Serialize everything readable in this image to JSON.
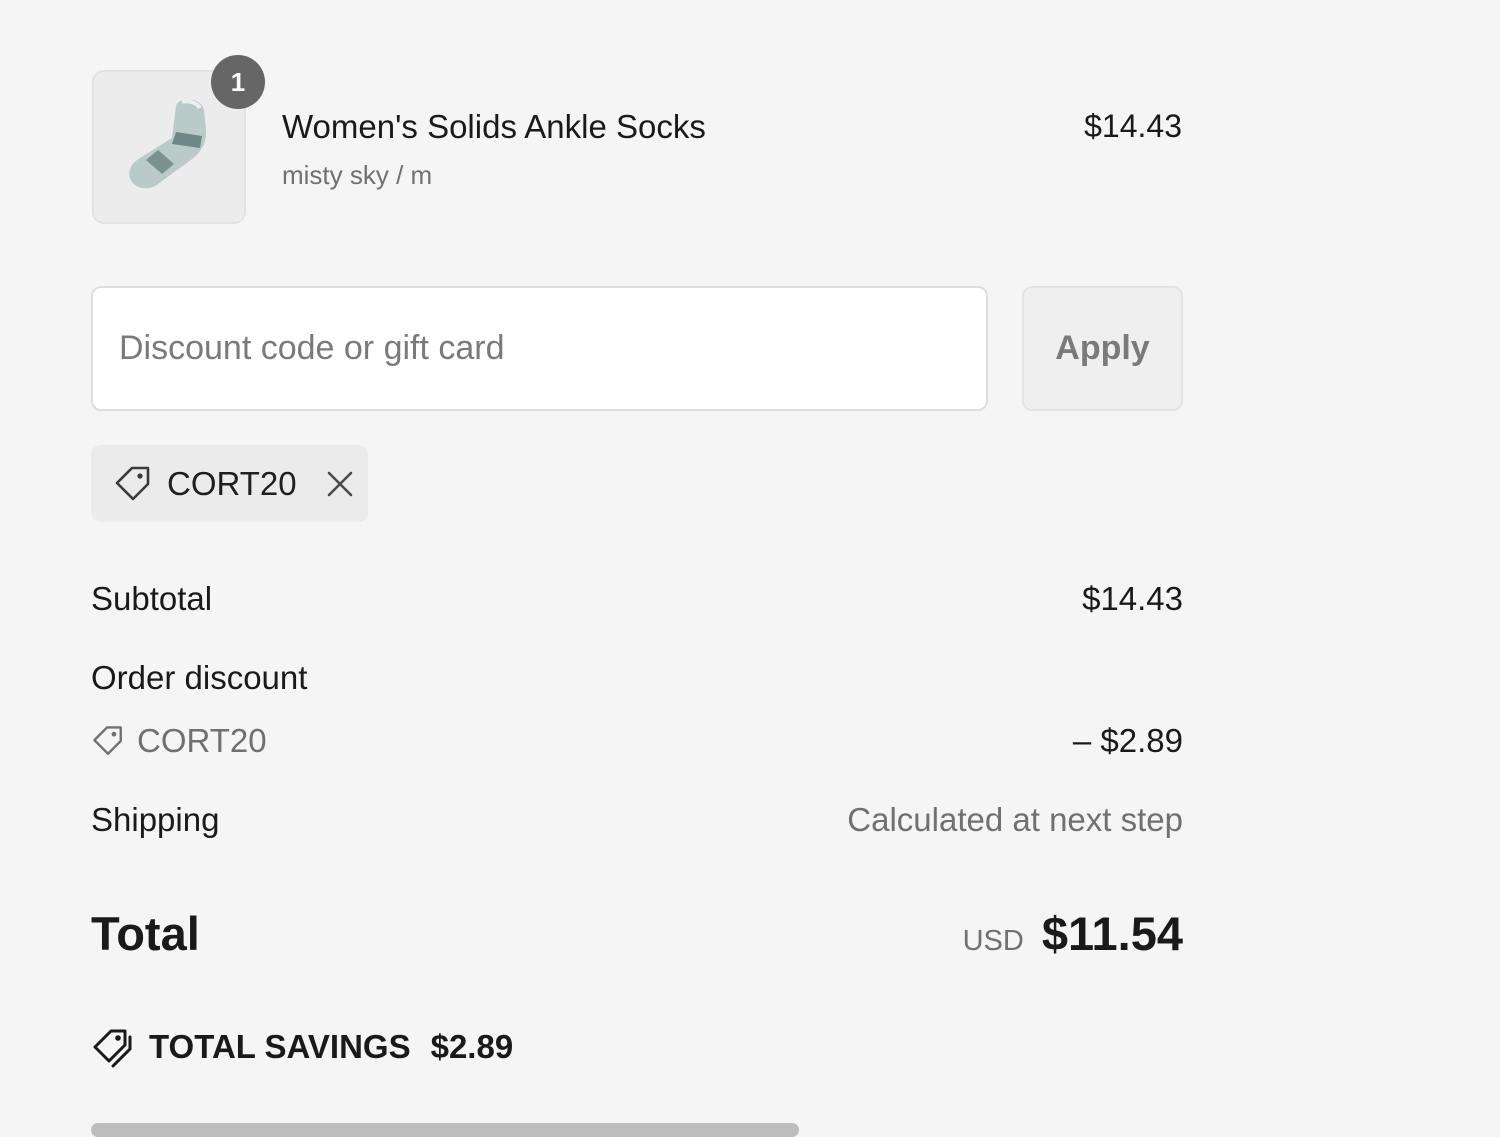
{
  "line_item": {
    "quantity": "1",
    "name": "Women's Solids Ankle Socks",
    "variant": "misty sky / m",
    "price": "$14.43",
    "image_icon": "sock-icon"
  },
  "discount": {
    "placeholder": "Discount code or gift card",
    "value": "",
    "apply_label": "Apply",
    "applied_code": "CORT20"
  },
  "summary": {
    "subtotal_label": "Subtotal",
    "subtotal_value": "$14.43",
    "order_discount_label": "Order discount",
    "order_discount_code": "CORT20",
    "order_discount_value": "– $2.89",
    "shipping_label": "Shipping",
    "shipping_value": "Calculated at next step",
    "total_label": "Total",
    "currency": "USD",
    "total_value": "$11.54",
    "savings_label": "TOTAL SAVINGS",
    "savings_value": "$2.89"
  },
  "colors": {
    "background": "#f5f5f5",
    "badge": "#666666",
    "muted_text": "#707070",
    "chip_background": "#ebebeb"
  }
}
